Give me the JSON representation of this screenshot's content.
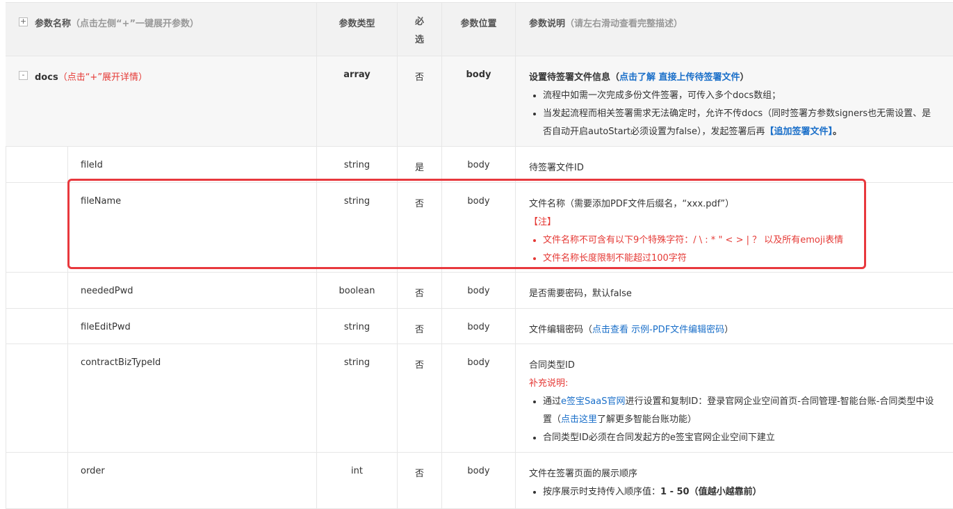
{
  "header": {
    "expand_toggle": "+",
    "col_name": "参数名称",
    "col_name_hint": "（点击左侧“+”一键展开参数）",
    "col_type": "参数类型",
    "col_required_1": "必",
    "col_required_2": "选",
    "col_position": "参数位置",
    "col_desc": "参数说明",
    "col_desc_hint": "（请左右滑动查看完整描述）"
  },
  "docs": {
    "toggle": "-",
    "name": "docs",
    "hint": "（点击“+”展开详情）",
    "type": "array",
    "required": "否",
    "position": "body",
    "desc_title": "设置待签署文件信息（",
    "desc_link1": "点击了解 直接上传待签署文件",
    "desc_title_end": "）",
    "bullet1": "流程中如需一次完成多份文件签署，可传入多个docs数组；",
    "bullet2_a": "当发起流程而相关签署需求无法确定时，允许不传docs（同时签署方参数signers也无需设置、是否自动开启autoStart必须设置为false），发起签署后再",
    "bullet2_link": "【追加签署文件】",
    "bullet2_end": "。"
  },
  "rows": [
    {
      "name": "fileId",
      "type": "string",
      "required": "是",
      "position": "body",
      "desc": "待签署文件ID"
    },
    {
      "name": "fileName",
      "type": "string",
      "required": "否",
      "position": "body",
      "desc": "文件名称（需要添加PDF文件后缀名，“xxx.pdf”）",
      "note_title": "【注】",
      "note1": "文件名称不可含有以下9个特殊字符：/ \\ : * \" < > | ？ 以及所有emoji表情",
      "note2": "文件名称长度限制不能超过100字符"
    },
    {
      "name": "neededPwd",
      "type": "boolean",
      "required": "否",
      "position": "body",
      "desc": "是否需要密码，默认false"
    },
    {
      "name": "fileEditPwd",
      "type": "string",
      "required": "否",
      "position": "body",
      "desc": "文件编辑密码（",
      "link": "点击查看 示例-PDF文件编辑密码",
      "desc_end": "）"
    },
    {
      "name": "contractBizTypeId",
      "type": "string",
      "required": "否",
      "position": "body",
      "desc": "合同类型ID",
      "note_title": "补充说明:",
      "b1_a": "通过",
      "b1_link": "e签宝SaaS官网",
      "b1_b": "进行设置和复制ID：登录官网企业空间首页-合同管理-智能台账-合同类型中设置（",
      "b1_link2": "点击这里",
      "b1_c": "了解更多智能台账功能）",
      "b2": "合同类型ID必须在合同发起方的e签宝官网企业空间下建立"
    },
    {
      "name": "order",
      "type": "int",
      "required": "否",
      "position": "body",
      "desc": "文件在签署页面的展示顺序",
      "b1_a": "按序展示时支持传入顺序值：",
      "b1_bold": "1 - 50",
      "b1_b": "（值越小越靠前）"
    }
  ]
}
